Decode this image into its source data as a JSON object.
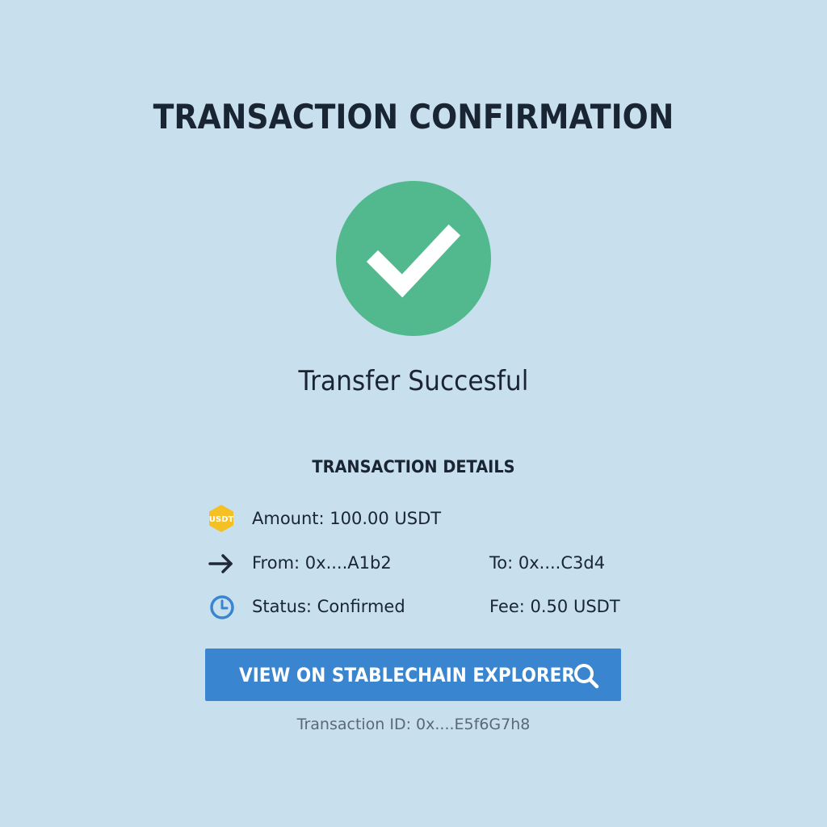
{
  "page": {
    "title": "TRANSACTION CONFIRMATION",
    "background_color": "#c8dfed"
  },
  "status": {
    "icon": "checkmark-icon",
    "icon_color": "#52b98f",
    "message": "Transfer Succesful"
  },
  "details": {
    "heading": "TRANSACTION DETAILS",
    "amount": {
      "icon": "usdt-token-icon",
      "icon_text": "USDT",
      "icon_color": "#f5c023",
      "label": "Amount: 100.00 USDT"
    },
    "from": {
      "icon": "arrow-right-icon",
      "label": "From: 0x....A1b2"
    },
    "to": {
      "label": "To: 0x....C3d4"
    },
    "status": {
      "icon": "clock-icon",
      "icon_color": "#3a85cf",
      "label": "Status: Confirmed"
    },
    "fee": {
      "label": "Fee: 0.50 USDT"
    }
  },
  "explorer_button": {
    "label": "VIEW ON STABLECHAIN EXPLORER",
    "icon": "search-icon",
    "color": "#3a85cf"
  },
  "transaction_id": "Transaction ID: 0x....E5f6G7h8"
}
